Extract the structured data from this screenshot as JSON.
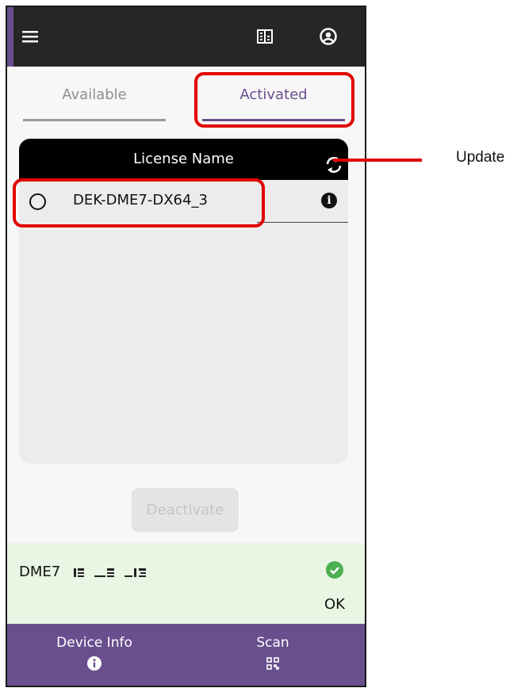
{
  "header": {
    "menu_icon": "hamburger-menu-icon",
    "building_icon": "building-icon",
    "account_icon": "account-circle-icon"
  },
  "tabs": {
    "available": "Available",
    "activated": "Activated",
    "active": "activated"
  },
  "table": {
    "header": "License Name",
    "refresh_icon": "refresh-icon",
    "rows": [
      {
        "name": "DEK-DME7-DX64_3",
        "selected": false,
        "info_icon": "info-icon"
      }
    ]
  },
  "actions": {
    "deactivate": "Deactivate"
  },
  "status": {
    "device": "DME7",
    "serial": "",
    "state": "OK",
    "state_icon": "check-circle-icon"
  },
  "bottom_nav": {
    "device_info": "Device Info",
    "device_info_icon": "info-icon",
    "scan": "Scan",
    "scan_icon": "qr-code-icon"
  },
  "annotation": {
    "label": "Update"
  },
  "colors": {
    "accent": "#6a4f8f",
    "topbar": "#262626",
    "highlight": "#e00000",
    "ok": "#4caf50",
    "status_bg": "#e8f6e3"
  }
}
